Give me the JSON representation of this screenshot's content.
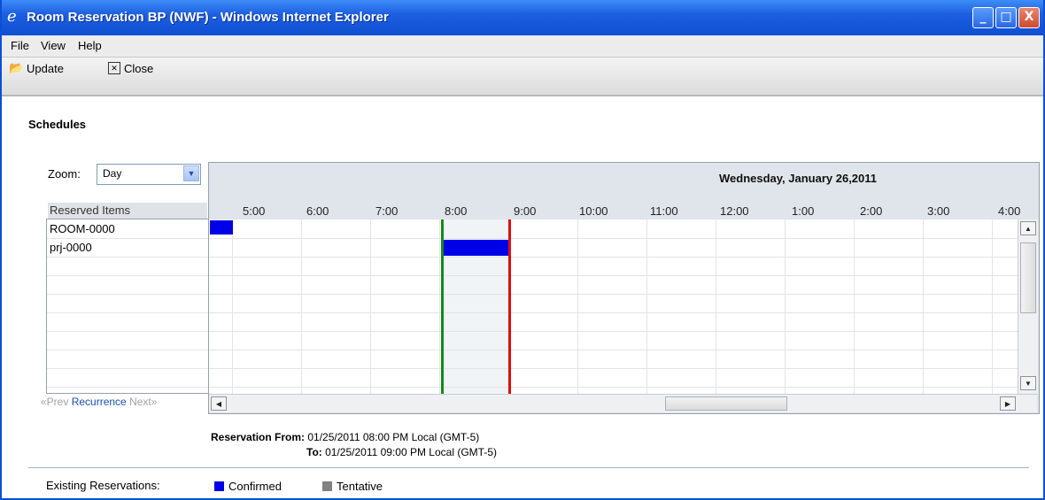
{
  "window": {
    "title": "Room Reservation BP (NWF) - Windows Internet Explorer"
  },
  "menu": [
    "File",
    "View",
    "Help"
  ],
  "toolbar": {
    "update_label": "Update",
    "close_label": "Close"
  },
  "section_title": "Schedules",
  "zoom": {
    "label": "Zoom:",
    "value": "Day"
  },
  "reserved": {
    "header": "Reserved Items",
    "items": [
      "ROOM-0000",
      "prj-0000"
    ]
  },
  "nav": {
    "prev": "«Prev",
    "recurrence": "Recurrence",
    "next": "Next»"
  },
  "schedule": {
    "date": "Wednesday, January 26,2011",
    "hours": [
      "5:00",
      "6:00",
      "7:00",
      "8:00",
      "9:00",
      "10:00",
      "11:00",
      "12:00",
      "1:00",
      "2:00",
      "3:00",
      "4:00"
    ]
  },
  "reservation": {
    "from_label": "Reservation From:",
    "from_value": "01/25/2011 08:00 PM Local (GMT-5)",
    "to_label": "To:",
    "to_value": "01/25/2011 09:00 PM Local (GMT-5)"
  },
  "legend": {
    "label": "Existing Reservations:",
    "confirmed": "Confirmed",
    "tentative": "Tentative",
    "confirmed_color": "#0000e8",
    "tentative_color": "#808080"
  },
  "colors": {
    "start_line": "#128a1a",
    "end_line": "#e10d0d",
    "titlebar": "#1d5fe0"
  }
}
